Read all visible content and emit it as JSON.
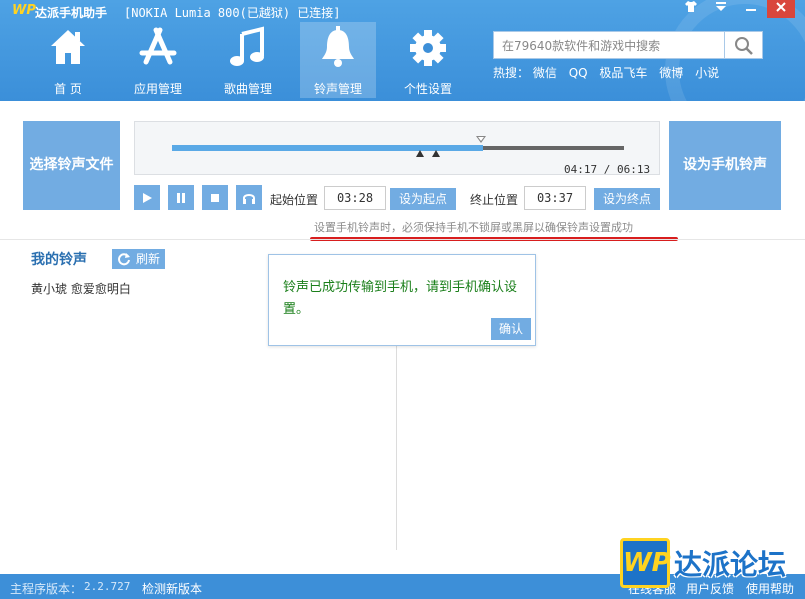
{
  "titlebar": {
    "logo": "WP",
    "app_name": "达派手机助手",
    "device": "[NOKIA Lumia 800(已越狱) 已连接]"
  },
  "nav": [
    {
      "label": "首 页",
      "icon": "home-icon"
    },
    {
      "label": "应用管理",
      "icon": "app-store-icon"
    },
    {
      "label": "歌曲管理",
      "icon": "music-note-icon"
    },
    {
      "label": "铃声管理",
      "icon": "bell-icon",
      "active": true
    },
    {
      "label": "个性设置",
      "icon": "gear-icon"
    }
  ],
  "search": {
    "placeholder": "在79640款软件和游戏中搜索",
    "hot_label": "热搜：",
    "hot_terms": [
      "微信",
      "QQ",
      "极品飞车",
      "微博",
      "小说"
    ]
  },
  "player": {
    "choose_file": "选择铃声文件",
    "set_ringtone": "设为手机铃声",
    "current_time": "04:17",
    "total_time": "06:13",
    "time_separator": " / ",
    "progress": 0.688,
    "start_label": "起始位置",
    "start_time": "03:28",
    "set_start": "设为起点",
    "end_label": "终止位置",
    "end_time": "03:37",
    "set_end": "设为终点",
    "notice": "设置手机铃声时，必须保持手机不锁屏或黑屏以确保铃声设置成功"
  },
  "ringtones": {
    "title": "我的铃声",
    "refresh": "刷新",
    "items": [
      "黄小琥 愈爱愈明白"
    ]
  },
  "dialog": {
    "message": "铃声已成功传输到手机，请到手机确认设置。",
    "confirm": "确认"
  },
  "footer": {
    "version_label": "主程序版本：",
    "version": "2.2.727",
    "check_update": "检测新版本",
    "links": [
      "在线客服",
      "用户反馈",
      "使用帮助"
    ]
  },
  "watermark": {
    "logo": "WP",
    "text": "达派论坛"
  },
  "colors": {
    "header": "#3b8fd9",
    "button": "#72ace2",
    "notice_underline": "#d81e1e",
    "dialog_text": "#1a7f1a"
  }
}
